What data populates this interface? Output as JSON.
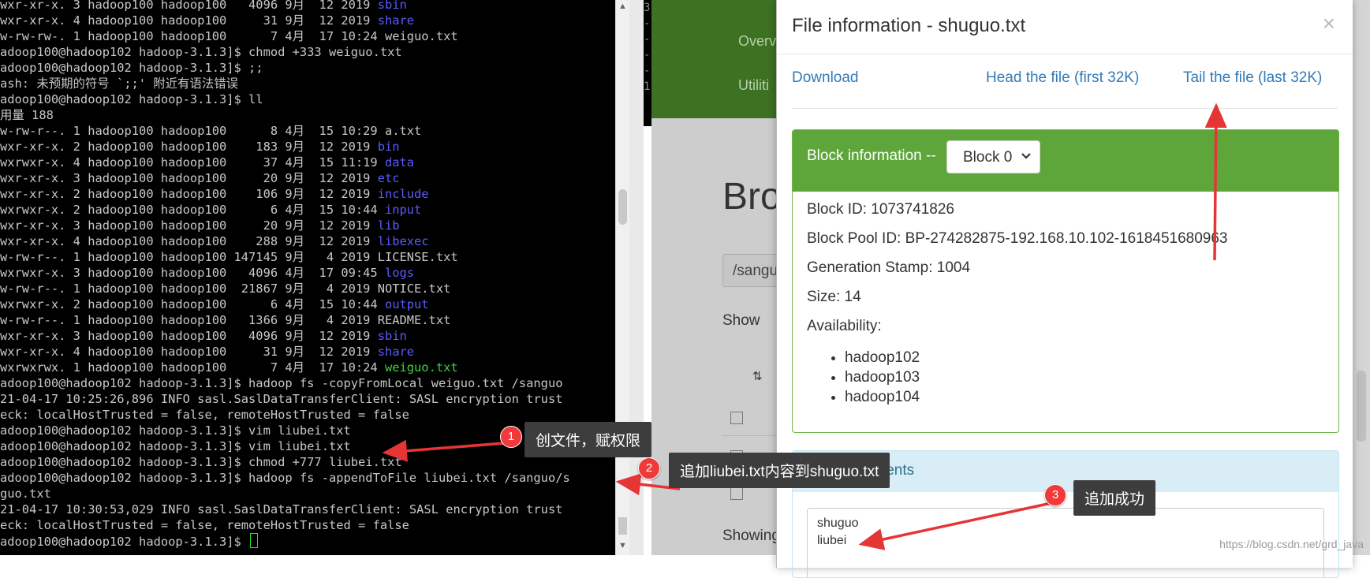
{
  "terminal": {
    "lines": [
      [
        {
          "t": "wxr-xr-x. 3 hadoop100 hadoop100   4096 9月  12 2019 "
        },
        {
          "t": "sbin",
          "c": "blue"
        }
      ],
      [
        {
          "t": "wxr-xr-x. 4 hadoop100 hadoop100     31 9月  12 2019 "
        },
        {
          "t": "share",
          "c": "blue"
        }
      ],
      [
        {
          "t": "w-rw-rw-. 1 hadoop100 hadoop100      7 4月  17 10:24 weiguo.txt"
        }
      ],
      [
        {
          "t": "adoop100@hadoop102 hadoop-3.1.3]$ chmod +333 weiguo.txt"
        }
      ],
      [
        {
          "t": "adoop100@hadoop102 hadoop-3.1.3]$ ;;"
        }
      ],
      [
        {
          "t": "ash: 未预期的符号 `;;' 附近有语法错误"
        }
      ],
      [
        {
          "t": "adoop100@hadoop102 hadoop-3.1.3]$ ll"
        }
      ],
      [
        {
          "t": "用量 188"
        }
      ],
      [
        {
          "t": "w-rw-r--. 1 hadoop100 hadoop100      8 4月  15 10:29 a.txt"
        }
      ],
      [
        {
          "t": "wxr-xr-x. 2 hadoop100 hadoop100    183 9月  12 2019 "
        },
        {
          "t": "bin",
          "c": "blue"
        }
      ],
      [
        {
          "t": "wxrwxr-x. 4 hadoop100 hadoop100     37 4月  15 11:19 "
        },
        {
          "t": "data",
          "c": "blue"
        }
      ],
      [
        {
          "t": "wxr-xr-x. 3 hadoop100 hadoop100     20 9月  12 2019 "
        },
        {
          "t": "etc",
          "c": "blue"
        }
      ],
      [
        {
          "t": "wxr-xr-x. 2 hadoop100 hadoop100    106 9月  12 2019 "
        },
        {
          "t": "include",
          "c": "blue"
        }
      ],
      [
        {
          "t": "wxrwxr-x. 2 hadoop100 hadoop100      6 4月  15 10:44 "
        },
        {
          "t": "input",
          "c": "blue"
        }
      ],
      [
        {
          "t": "wxr-xr-x. 3 hadoop100 hadoop100     20 9月  12 2019 "
        },
        {
          "t": "lib",
          "c": "blue"
        }
      ],
      [
        {
          "t": "wxr-xr-x. 4 hadoop100 hadoop100    288 9月  12 2019 "
        },
        {
          "t": "libexec",
          "c": "blue"
        }
      ],
      [
        {
          "t": "w-rw-r--. 1 hadoop100 hadoop100 147145 9月   4 2019 LICENSE.txt"
        }
      ],
      [
        {
          "t": "wxrwxr-x. 3 hadoop100 hadoop100   4096 4月  17 09:45 "
        },
        {
          "t": "logs",
          "c": "blue"
        }
      ],
      [
        {
          "t": "w-rw-r--. 1 hadoop100 hadoop100  21867 9月   4 2019 NOTICE.txt"
        }
      ],
      [
        {
          "t": "wxrwxr-x. 2 hadoop100 hadoop100      6 4月  15 10:44 "
        },
        {
          "t": "output",
          "c": "blue"
        }
      ],
      [
        {
          "t": "w-rw-r--. 1 hadoop100 hadoop100   1366 9月   4 2019 README.txt"
        }
      ],
      [
        {
          "t": "wxr-xr-x. 3 hadoop100 hadoop100   4096 9月  12 2019 "
        },
        {
          "t": "sbin",
          "c": "blue"
        }
      ],
      [
        {
          "t": "wxr-xr-x. 4 hadoop100 hadoop100     31 9月  12 2019 "
        },
        {
          "t": "share",
          "c": "blue"
        }
      ],
      [
        {
          "t": "wxrwxrwx. 1 hadoop100 hadoop100      7 4月  17 10:24 "
        },
        {
          "t": "weiguo.txt",
          "c": "green"
        }
      ],
      [
        {
          "t": "adoop100@hadoop102 hadoop-3.1.3]$ hadoop fs -copyFromLocal weiguo.txt /sanguo"
        }
      ],
      [
        {
          "t": "21-04-17 10:25:26,896 INFO sasl.SaslDataTransferClient: SASL encryption trust"
        }
      ],
      [
        {
          "t": "eck: localHostTrusted = false, remoteHostTrusted = false"
        }
      ],
      [
        {
          "t": "adoop100@hadoop102 hadoop-3.1.3]$ vim liubei.txt"
        }
      ],
      [
        {
          "t": "adoop100@hadoop102 hadoop-3.1.3]$ vim liubei.txt"
        }
      ],
      [
        {
          "t": "adoop100@hadoop102 hadoop-3.1.3]$ chmod +777 liubei.txt"
        }
      ],
      [
        {
          "t": "adoop100@hadoop102 hadoop-3.1.3]$ hadoop fs -appendToFile liubei.txt /sanguo/s"
        }
      ],
      [
        {
          "t": "guo.txt"
        }
      ],
      [
        {
          "t": "21-04-17 10:30:53,029 INFO sasl.SaslDataTransferClient: SASL encryption trust"
        }
      ],
      [
        {
          "t": "eck: localHostTrusted = false, remoteHostTrusted = false"
        }
      ],
      [
        {
          "t": "adoop100@hadoop102 hadoop-3.1.3]$ "
        }
      ]
    ],
    "second_terminal_fragments": [
      "3",
      "-",
      "-",
      "-",
      "-",
      "1"
    ]
  },
  "browser_background": {
    "nav_items": [
      "Overv",
      "Utiliti"
    ],
    "heading": "Bro",
    "path_value": "/sangu",
    "show_label": "Show",
    "showing_label": "Showing"
  },
  "modal": {
    "title": "File information - shuguo.txt",
    "close": "×",
    "links": {
      "download": "Download",
      "head": "Head the file (first 32K)",
      "tail": "Tail the file (last 32K)"
    },
    "block_panel": {
      "label": "Block information --",
      "select_value": "Block 0",
      "block_id": "Block ID: 1073741826",
      "block_pool_id": "Block Pool ID: BP-274282875-192.168.10.102-1618451680963",
      "generation_stamp": "Generation Stamp: 1004",
      "size": "Size: 14",
      "availability_label": "Availability:",
      "availability": [
        "hadoop102",
        "hadoop103",
        "hadoop104"
      ]
    },
    "contents_panel": {
      "label": "ile contents",
      "lines": [
        "shuguo",
        "liubei"
      ]
    }
  },
  "annotations": [
    {
      "number": "1",
      "text": "创文件，赋权限"
    },
    {
      "number": "2",
      "text": "追加liubei.txt内容到shuguo.txt"
    },
    {
      "number": "3",
      "text": "追加成功"
    }
  ],
  "watermark": "https://blog.csdn.net/grd_java",
  "colors": {
    "terminal_bg": "#000000",
    "dir_blue": "#5b5bff",
    "exec_green": "#3fd33f",
    "panel_success": "#5ea63a",
    "panel_info": "#d9edf7",
    "link_blue": "#337ab7",
    "annotation_red": "#f03a3a"
  }
}
